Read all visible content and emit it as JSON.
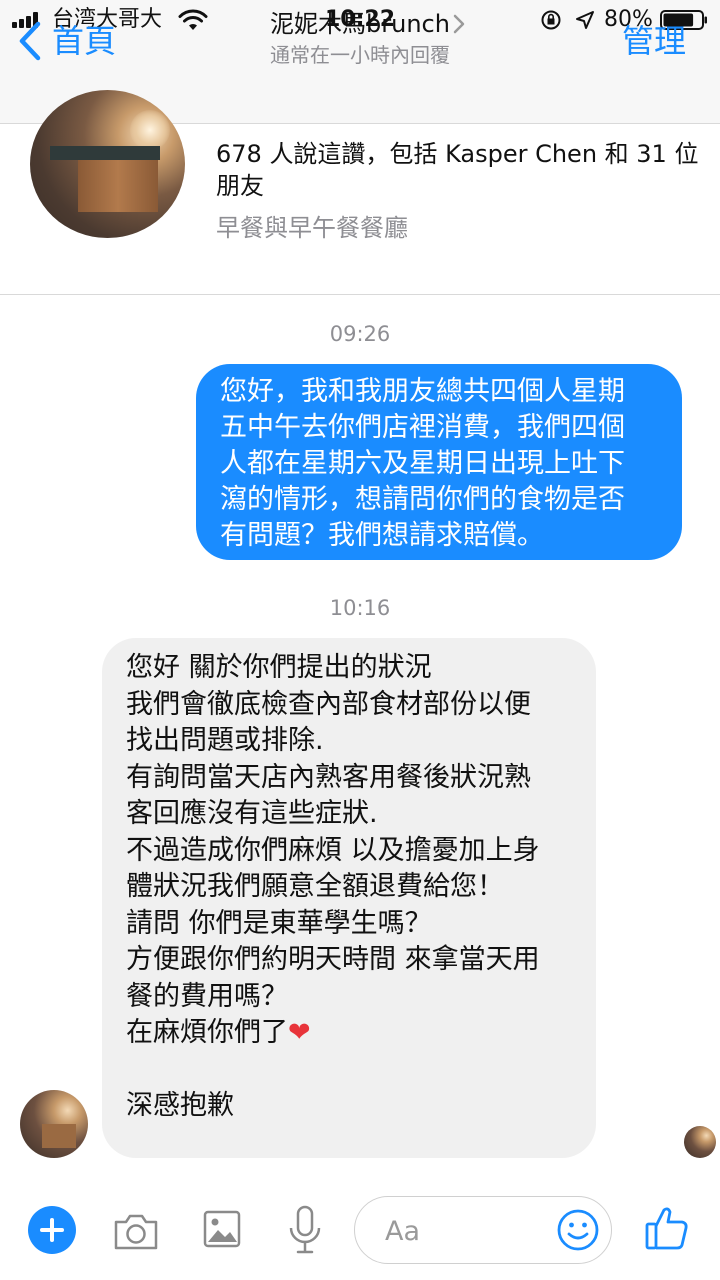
{
  "status_bar": {
    "carrier": "台湾大哥大",
    "time": "10:22",
    "battery": "80%",
    "battery_level": 0.8
  },
  "nav": {
    "back_label": "首頁",
    "title": "泥妮木馬brunch",
    "subtitle": "通常在一小時內回覆",
    "manage_label": "管理"
  },
  "page_header": {
    "likes": "678 人說這讚，包括 Kasper Chen 和 31 位朋友",
    "category": "早餐與早午餐餐廳"
  },
  "thread": {
    "timestamp_1": "09:26",
    "outgoing_lines": [
      "您好，我和我朋友總共四個人星期",
      "五中午去你們店裡消費，我們四個",
      "人都在星期六及星期日出現上吐下",
      "瀉的情形，想請問你們的食物是否",
      "有問題？我們想請求賠償。"
    ],
    "timestamp_2": "10:16",
    "incoming_lines": [
      "您好 關於你們提出的狀況",
      "我們會徹底檢查內部食材部份以便",
      "找出問題或排除.",
      "有詢問當天店內熟客用餐後狀況熟",
      "客回應沒有這些症狀.",
      "不過造成你們麻煩 以及擔憂加上身",
      "體狀況我們願意全額退費給您！",
      "請問 你們是東華學生嗎？",
      "方便跟你們約明天時間 來拿當天用",
      "餐的費用嗎？",
      "在麻煩你們了",
      "",
      "深感抱歉"
    ],
    "heart": "❤"
  },
  "composer": {
    "placeholder": "Aa",
    "icons": [
      "plus-icon",
      "camera-icon",
      "image-icon",
      "microphone-icon",
      "emoji-icon",
      "thumbs-up-icon"
    ]
  },
  "colors": {
    "accent": "#1a8cff",
    "incoming_bubble": "#f0f0f0",
    "heart": "#e8343a"
  }
}
